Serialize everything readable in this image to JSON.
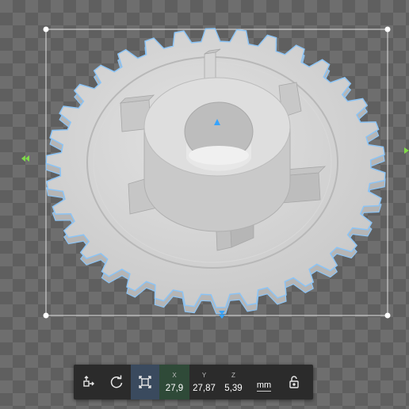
{
  "toolbar": {
    "buttons": [
      {
        "icon": "move-icon"
      },
      {
        "icon": "rotate-icon"
      },
      {
        "icon": "scale-icon",
        "active": true
      }
    ],
    "dimensions": {
      "x": {
        "label": "X",
        "value": "27,9"
      },
      "y": {
        "label": "Y",
        "value": "27,87"
      },
      "z": {
        "label": "Z",
        "value": "5,39"
      }
    },
    "unit": "mm",
    "lock_icon": "unlock-icon"
  },
  "colors": {
    "selection_outline": "#8cc4f5",
    "gear": "#d4d4d4",
    "axis_x_handle": "#7fd94a",
    "axis_y_handle": "#37a4ff"
  }
}
